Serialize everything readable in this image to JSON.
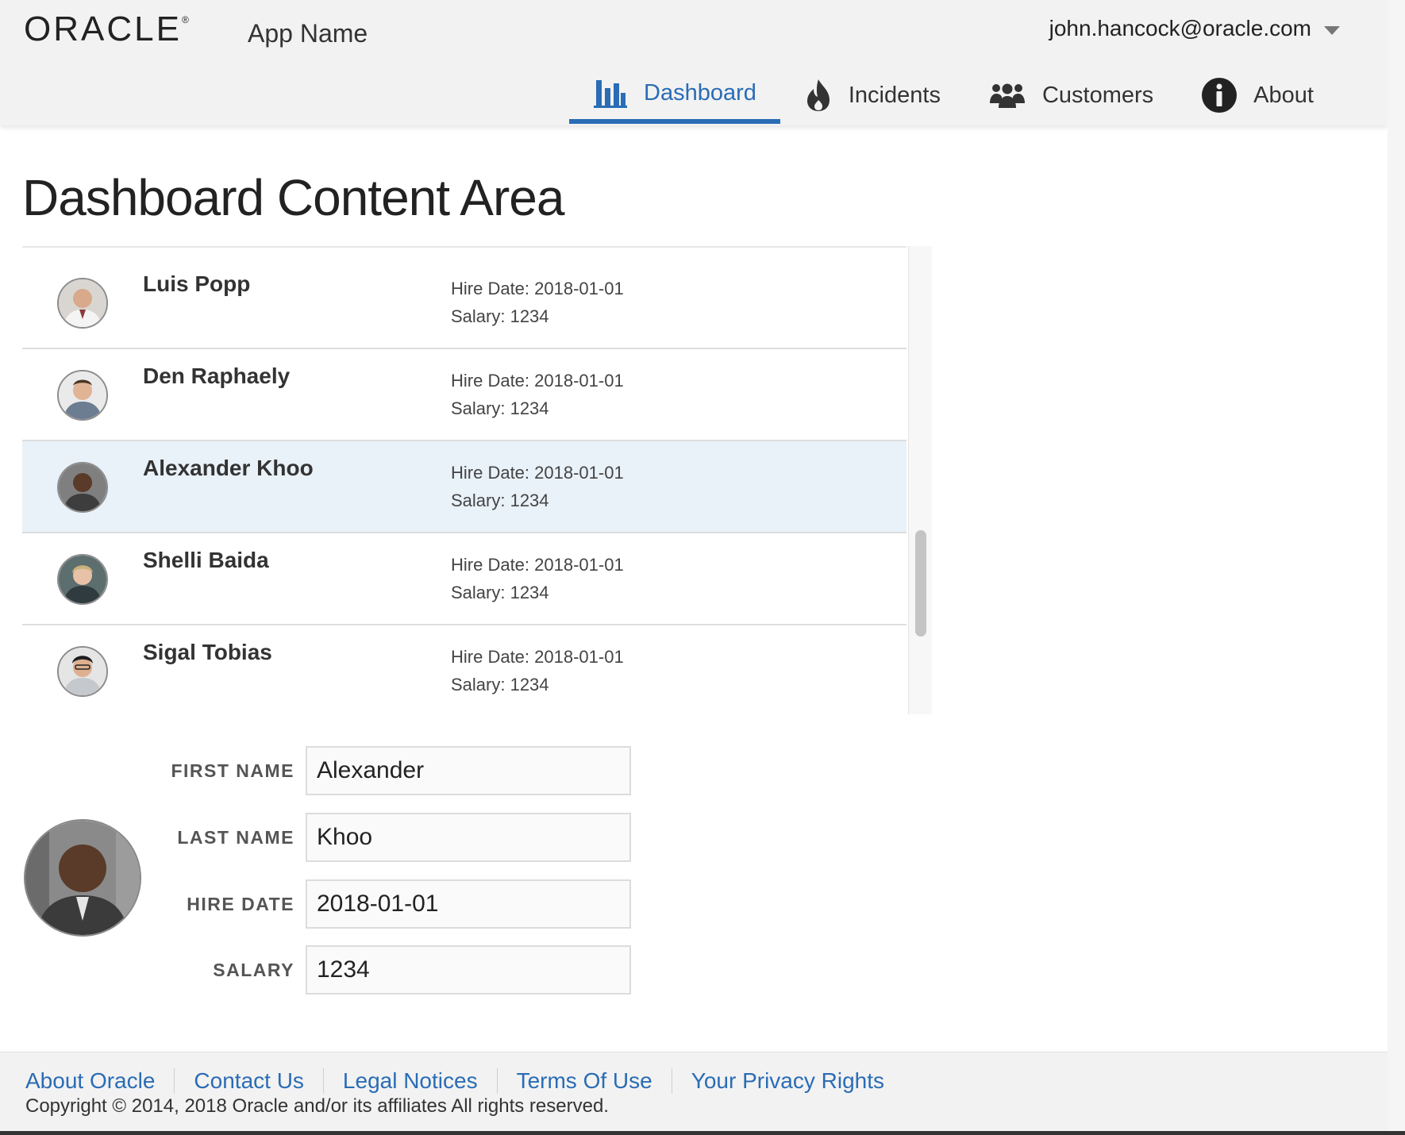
{
  "header": {
    "logo_text": "ORACLE",
    "logo_mark": "®",
    "app_name": "App Name",
    "user_email": "john.hancock@oracle.com"
  },
  "nav": {
    "items": [
      {
        "label": "Dashboard",
        "icon": "bar-chart-icon",
        "active": true
      },
      {
        "label": "Incidents",
        "icon": "fire-icon",
        "active": false
      },
      {
        "label": "Customers",
        "icon": "people-icon",
        "active": false
      },
      {
        "label": "About",
        "icon": "info-icon",
        "active": false
      }
    ]
  },
  "main": {
    "title": "Dashboard Content Area",
    "employees": [
      {
        "name": "Luis Popp",
        "hire_date": "Hire Date: 2018-01-01",
        "salary": "Salary: 1234",
        "selected": false
      },
      {
        "name": "Den Raphaely",
        "hire_date": "Hire Date: 2018-01-01",
        "salary": "Salary: 1234",
        "selected": false
      },
      {
        "name": "Alexander Khoo",
        "hire_date": "Hire Date: 2018-01-01",
        "salary": "Salary: 1234",
        "selected": true
      },
      {
        "name": "Shelli Baida",
        "hire_date": "Hire Date: 2018-01-01",
        "salary": "Salary: 1234",
        "selected": false
      },
      {
        "name": "Sigal Tobias",
        "hire_date": "Hire Date: 2018-01-01",
        "salary": "Salary: 1234",
        "selected": false
      }
    ]
  },
  "form": {
    "first_name_label": "FIRST NAME",
    "first_name_value": "Alexander",
    "last_name_label": "LAST NAME",
    "last_name_value": "Khoo",
    "hire_date_label": "HIRE DATE",
    "hire_date_value": "2018-01-01",
    "salary_label": "SALARY",
    "salary_value": "1234"
  },
  "footer": {
    "links": [
      "About Oracle",
      "Contact Us",
      "Legal Notices",
      "Terms Of Use",
      "Your Privacy Rights"
    ],
    "copyright": "Copyright © 2014, 2018 Oracle and/or its affiliates All rights reserved."
  },
  "colors": {
    "accent": "#2a6cb5",
    "selected_row": "#e9f1f9",
    "header_bg": "#f2f2f2"
  }
}
